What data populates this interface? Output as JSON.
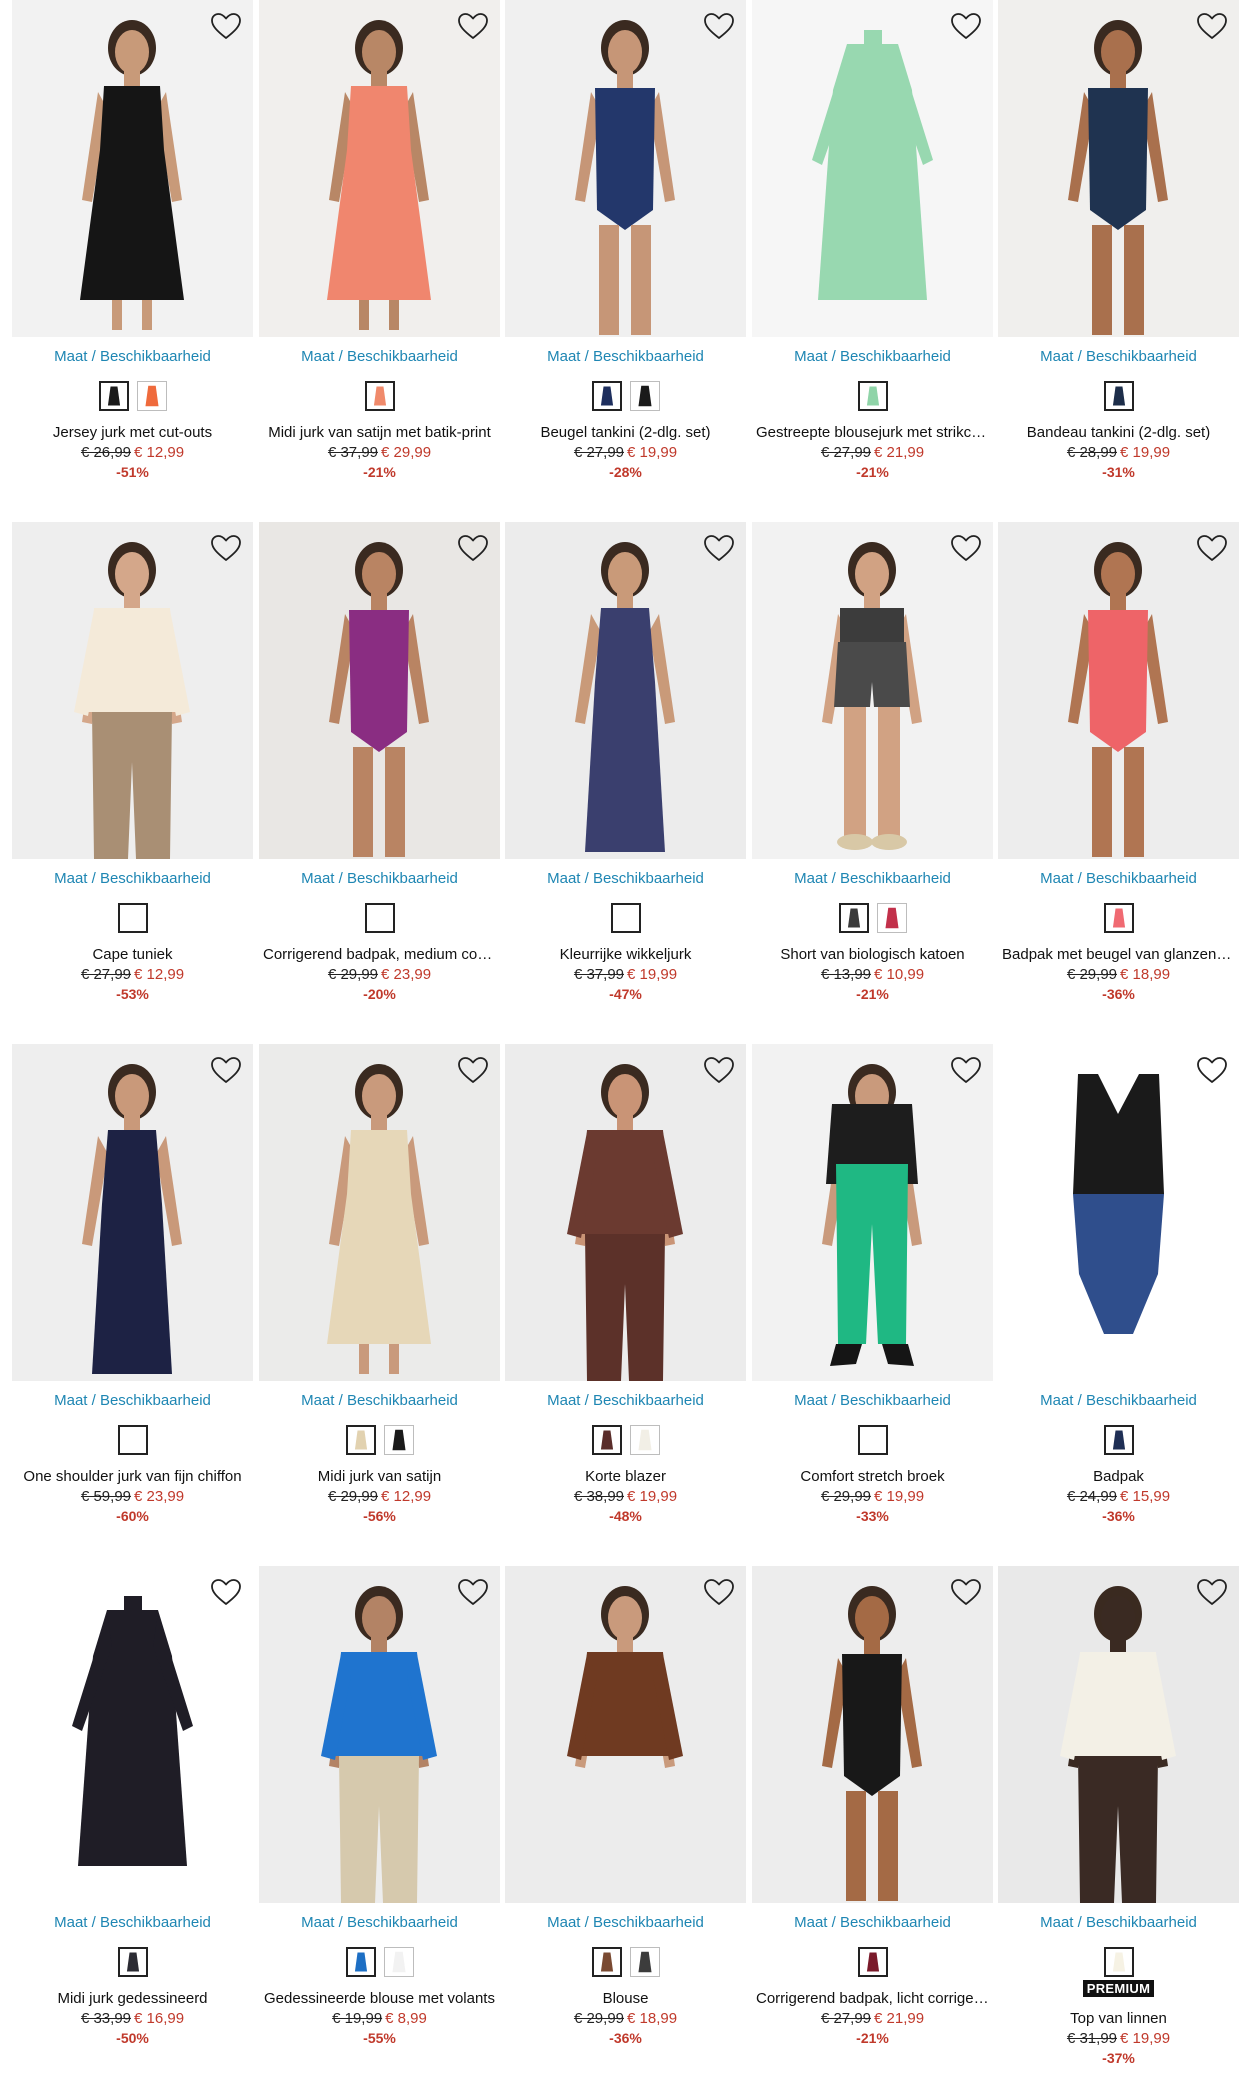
{
  "colors": {
    "accent": "#1e86b3",
    "sale": "#c0392b",
    "text": "#111111"
  },
  "avail_label": "Maat / Beschikbaarheid",
  "products": [
    {
      "name": "Jersey jurk met cut-outs",
      "old": "€ 26,99",
      "new": "€ 12,99",
      "disc": "-51%",
      "swatches": [
        "#1a1a1a",
        "#ef6a3c"
      ],
      "bg": "#f2f2f2",
      "garment": "#151515",
      "skin": "#c89a79",
      "shape": "dress",
      "pants": ""
    },
    {
      "name": "Midi jurk van satijn met batik-print",
      "old": "€ 37,99",
      "new": "€ 29,99",
      "disc": "-21%",
      "swatches": [
        "#f08a6b"
      ],
      "bg": "#f1efed",
      "garment": "#f0866e",
      "skin": "#b88766",
      "shape": "dress",
      "pants": ""
    },
    {
      "name": "Beugel tankini (2-dlg. set)",
      "old": "€ 27,99",
      "new": "€ 19,99",
      "disc": "-28%",
      "swatches": [
        "#1e2f5e",
        "#1a1a1a"
      ],
      "bg": "#f0f0f0",
      "garment": "#23376b",
      "skin": "#c69677",
      "shape": "swim",
      "pants": ""
    },
    {
      "name": "Gestreepte blousejurk met strikceintuur",
      "old": "€ 27,99",
      "new": "€ 21,99",
      "disc": "-21%",
      "swatches": [
        "#8fd4a8"
      ],
      "bg": "#f6f6f6",
      "garment": "#98d8b0",
      "skin": "",
      "shape": "flat",
      "pants": ""
    },
    {
      "name": "Bandeau tankini (2-dlg. set)",
      "old": "€ 28,99",
      "new": "€ 19,99",
      "disc": "-31%",
      "swatches": [
        "#1d2e4a"
      ],
      "bg": "#f0efed",
      "garment": "#1f3350",
      "skin": "#a9704d",
      "shape": "swim",
      "pants": ""
    },
    {
      "name": "Cape tuniek",
      "old": "€ 27,99",
      "new": "€ 12,99",
      "disc": "-53%",
      "swatches": [
        "#ffffff"
      ],
      "bg": "#eeeeee",
      "garment": "#f4ead9",
      "skin": "#d4a78a",
      "shape": "top",
      "pants": "#a98f74"
    },
    {
      "name": "Corrigerend badpak, medium corrigerend",
      "old": "€ 29,99",
      "new": "€ 23,99",
      "disc": "-20%",
      "swatches": [
        "#ffffff"
      ],
      "bg": "#e9e7e4",
      "garment": "#8a2d82",
      "skin": "#b98463",
      "shape": "swim",
      "pants": ""
    },
    {
      "name": "Kleurrijke wikkeljurk",
      "old": "€ 37,99",
      "new": "€ 19,99",
      "disc": "-47%",
      "swatches": [
        "#ffffff"
      ],
      "bg": "#ececec",
      "garment": "#3a3f6e",
      "skin": "#c99a79",
      "shape": "gown",
      "pants": ""
    },
    {
      "name": "Short van biologisch katoen",
      "old": "€ 13,99",
      "new": "€ 10,99",
      "disc": "-21%",
      "swatches": [
        "#3a3a3a",
        "#c2304a"
      ],
      "bg": "#f2f2f2",
      "garment": "#4a4a4a",
      "skin": "#d1a283",
      "shape": "shorts",
      "pants": ""
    },
    {
      "name": "Badpak met beugel van glanzend materiaal",
      "old": "€ 29,99",
      "new": "€ 18,99",
      "disc": "-36%",
      "swatches": [
        "#f06a72"
      ],
      "bg": "#ededed",
      "garment": "#ee6468",
      "skin": "#b07552",
      "shape": "swim",
      "pants": ""
    },
    {
      "name": "One shoulder jurk van fijn chiffon",
      "old": "€ 59,99",
      "new": "€ 23,99",
      "disc": "-60%",
      "swatches": [
        "#ffffff"
      ],
      "bg": "#eeeeee",
      "garment": "#1d2244",
      "skin": "#c9997a",
      "shape": "gown",
      "pants": ""
    },
    {
      "name": "Midi jurk van satijn",
      "old": "€ 29,99",
      "new": "€ 12,99",
      "disc": "-56%",
      "swatches": [
        "#e2d2b0",
        "#1a1a1a"
      ],
      "bg": "#ebebea",
      "garment": "#e6d7b8",
      "skin": "",
      "shape": "dress",
      "pants": ""
    },
    {
      "name": "Korte blazer",
      "old": "€ 38,99",
      "new": "€ 19,99",
      "disc": "-48%",
      "swatches": [
        "#5a2d2a",
        "#f2efe6"
      ],
      "bg": "#ececec",
      "garment": "#6b3a30",
      "skin": "#c99476",
      "shape": "top",
      "pants": "#5c3129"
    },
    {
      "name": "Comfort stretch broek",
      "old": "€ 29,99",
      "new": "€ 19,99",
      "disc": "-33%",
      "swatches": [
        "#ffffff"
      ],
      "bg": "#f2f2f2",
      "garment": "#1d1d1d",
      "skin": "",
      "shape": "pants",
      "pants": "#1fb883"
    },
    {
      "name": "Badpak",
      "old": "€ 24,99",
      "new": "€ 15,99",
      "disc": "-36%",
      "swatches": [
        "#1f2f55"
      ],
      "bg": "#ffffff",
      "garment": "#1a1a1a",
      "skin": "",
      "shape": "flatswim",
      "pants": "#2f4e8c"
    },
    {
      "name": "Midi jurk gedessineerd",
      "old": "€ 33,99",
      "new": "€ 16,99",
      "disc": "-50%",
      "swatches": [
        "#2b2b33"
      ],
      "bg": "#ffffff",
      "garment": "#1f1d26",
      "skin": "",
      "shape": "flat",
      "pants": ""
    },
    {
      "name": "Gedessineerde blouse met volants",
      "old": "€ 19,99",
      "new": "€ 8,99",
      "disc": "-55%",
      "swatches": [
        "#1d6fc4",
        "#f2f2f2"
      ],
      "bg": "#ededed",
      "garment": "#1f74cf",
      "skin": "#b38365",
      "shape": "top",
      "pants": "#d6c9ad"
    },
    {
      "name": "Blouse",
      "old": "€ 29,99",
      "new": "€ 18,99",
      "disc": "-36%",
      "swatches": [
        "#7a4a32",
        "#3c3c3c"
      ],
      "bg": "#ececec",
      "garment": "#6f3a21",
      "skin": "#c99a7c",
      "shape": "top",
      "pants": ""
    },
    {
      "name": "Corrigerend badpak, licht corrigerend",
      "old": "€ 27,99",
      "new": "€ 21,99",
      "disc": "-21%",
      "swatches": [
        "#7a1a2a"
      ],
      "bg": "#ededed",
      "garment": "#181818",
      "skin": "#a46a45",
      "shape": "swim",
      "pants": ""
    },
    {
      "name": "Top van linnen",
      "old": "€ 31,99",
      "new": "€ 19,99",
      "disc": "-37%",
      "swatches": [
        "#f6f2e4"
      ],
      "bg": "#e9e9e9",
      "garment": "#f3f0e6",
      "skin": "#3a2a22",
      "shape": "top",
      "pants": "#3a2a24",
      "badge": "PREMIUM"
    }
  ]
}
